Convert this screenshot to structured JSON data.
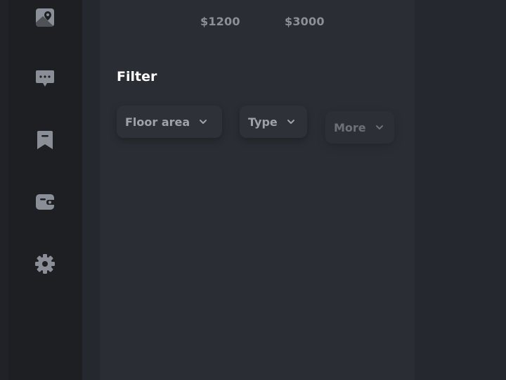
{
  "sidebar": {
    "items": [
      {
        "icon": "map-image-icon"
      },
      {
        "icon": "chat-bubble-icon"
      },
      {
        "icon": "bookmark-icon"
      },
      {
        "icon": "wallet-icon"
      },
      {
        "icon": "gear-icon"
      }
    ]
  },
  "price_range": {
    "min_label": "$1200",
    "max_label": "$3000"
  },
  "filter": {
    "title": "Filter",
    "chips": [
      {
        "label": "Floor area"
      },
      {
        "label": "Type"
      },
      {
        "label": "More"
      }
    ]
  },
  "colors": {
    "background": "#25282e",
    "sidebar": "#1d1f23",
    "panel": "#2a2d33",
    "icon": "#8a8e96",
    "title": "#ffffff"
  }
}
